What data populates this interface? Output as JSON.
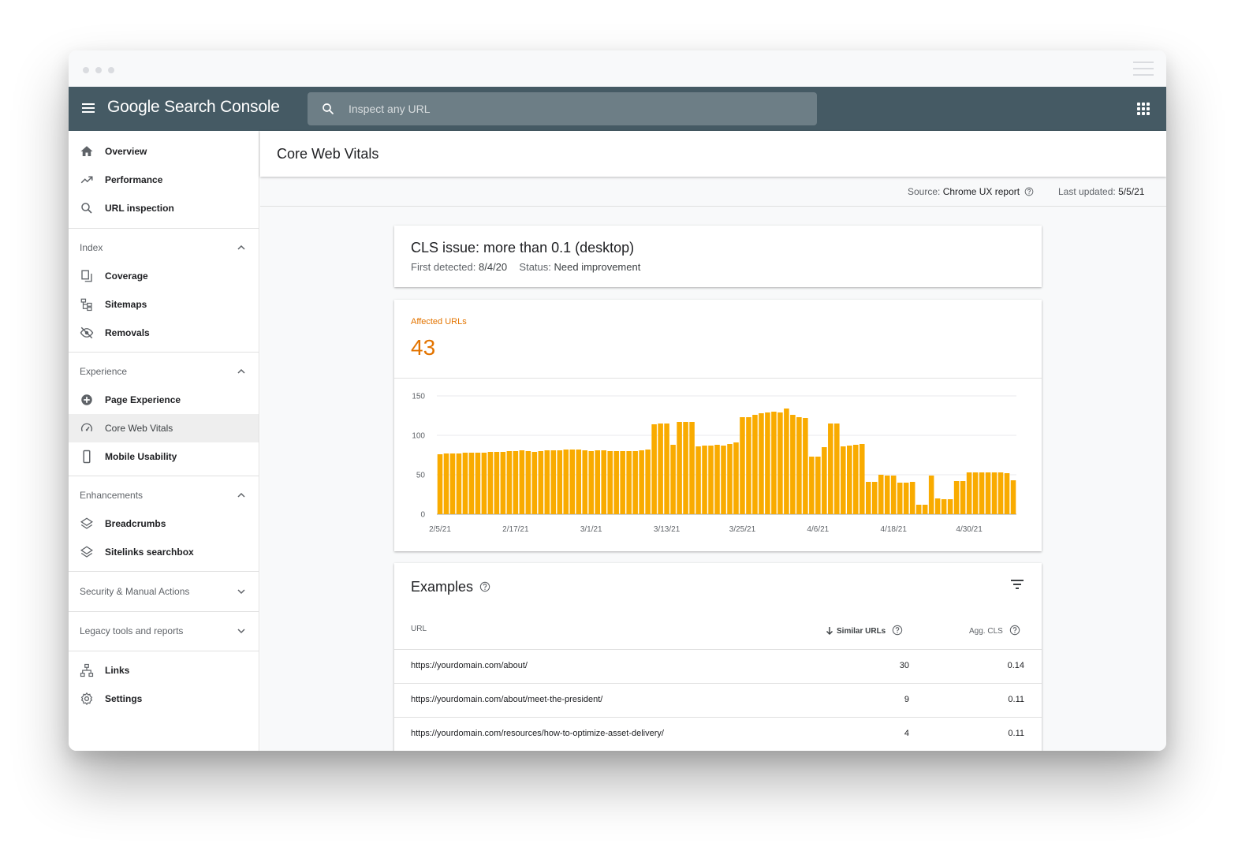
{
  "app": {
    "title": "Google Search Console",
    "search_placeholder": "Inspect any URL"
  },
  "sidebar": {
    "top_items": [
      {
        "label": "Overview",
        "icon": "home-icon"
      },
      {
        "label": "Performance",
        "icon": "trending-up-icon"
      },
      {
        "label": "URL inspection",
        "icon": "search-icon"
      }
    ],
    "index": {
      "label": "Index",
      "items": [
        {
          "label": "Coverage",
          "icon": "coverage-icon"
        },
        {
          "label": "Sitemaps",
          "icon": "sitemap-icon"
        },
        {
          "label": "Removals",
          "icon": "eye-off-icon"
        }
      ]
    },
    "experience": {
      "label": "Experience",
      "items": [
        {
          "label": "Page Experience",
          "icon": "plus-circle-icon"
        },
        {
          "label": "Core Web Vitals",
          "icon": "speedometer-icon"
        },
        {
          "label": "Mobile Usability",
          "icon": "phone-icon"
        }
      ]
    },
    "enhancements": {
      "label": "Enhancements",
      "items": [
        {
          "label": "Breadcrumbs",
          "icon": "layers-icon"
        },
        {
          "label": "Sitelinks searchbox",
          "icon": "layers-icon"
        }
      ]
    },
    "security": {
      "label": "Security & Manual Actions"
    },
    "legacy": {
      "label": "Legacy tools and reports"
    },
    "bottom_items": [
      {
        "label": "Links",
        "icon": "links-icon"
      },
      {
        "label": "Settings",
        "icon": "gear-icon"
      }
    ]
  },
  "page": {
    "title": "Core Web Vitals",
    "source_label": "Source:",
    "source_value": "Chrome UX report",
    "updated_label": "Last updated:",
    "updated_value": "5/5/21"
  },
  "issue": {
    "title": "CLS issue: more than 0.1 (desktop)",
    "first_detected_label": "First detected:",
    "first_detected_value": "8/4/20",
    "status_label": "Status:",
    "status_value": "Need improvement"
  },
  "affected": {
    "label": "Affected URLs",
    "count": "43"
  },
  "chart_data": {
    "type": "bar",
    "color": "#f9ab00",
    "ylim": [
      0,
      150
    ],
    "yticks": [
      0,
      50,
      100,
      150
    ],
    "xtick_labels": [
      "2/5/21",
      "2/17/21",
      "3/1/21",
      "3/13/21",
      "3/25/21",
      "4/6/21",
      "4/18/21",
      "4/30/21"
    ],
    "xtick_indices": [
      0,
      12,
      24,
      36,
      48,
      60,
      72,
      84
    ],
    "values": [
      76,
      77,
      77,
      77,
      78,
      78,
      78,
      78,
      79,
      79,
      79,
      80,
      80,
      81,
      80,
      79,
      80,
      81,
      81,
      81,
      82,
      82,
      82,
      81,
      80,
      81,
      81,
      80,
      80,
      80,
      80,
      80,
      81,
      82,
      114,
      115,
      115,
      88,
      117,
      117,
      117,
      86,
      87,
      87,
      88,
      87,
      89,
      91,
      123,
      123,
      126,
      128,
      129,
      130,
      129,
      134,
      126,
      123,
      122,
      73,
      73,
      85,
      115,
      115,
      86,
      87,
      88,
      89,
      41,
      41,
      50,
      49,
      49,
      40,
      40,
      41,
      12,
      12,
      49,
      20,
      19,
      19,
      42,
      42,
      53,
      53,
      53,
      53,
      53,
      53,
      52,
      43
    ]
  },
  "examples": {
    "title": "Examples",
    "columns": {
      "url": "URL",
      "similar": "Similar URLs",
      "agg": "Agg. CLS"
    },
    "rows": [
      {
        "url": "https://yourdomain.com/about/",
        "similar": "30",
        "agg": "0.14"
      },
      {
        "url": "https://yourdomain.com/about/meet-the-president/",
        "similar": "9",
        "agg": "0.11"
      },
      {
        "url": "https://yourdomain.com/resources/how-to-optimize-asset-delivery/",
        "similar": "4",
        "agg": "0.11"
      }
    ]
  },
  "colors": {
    "appbar": "#455a64",
    "accent": "#e37400",
    "bar": "#f9ab00"
  }
}
